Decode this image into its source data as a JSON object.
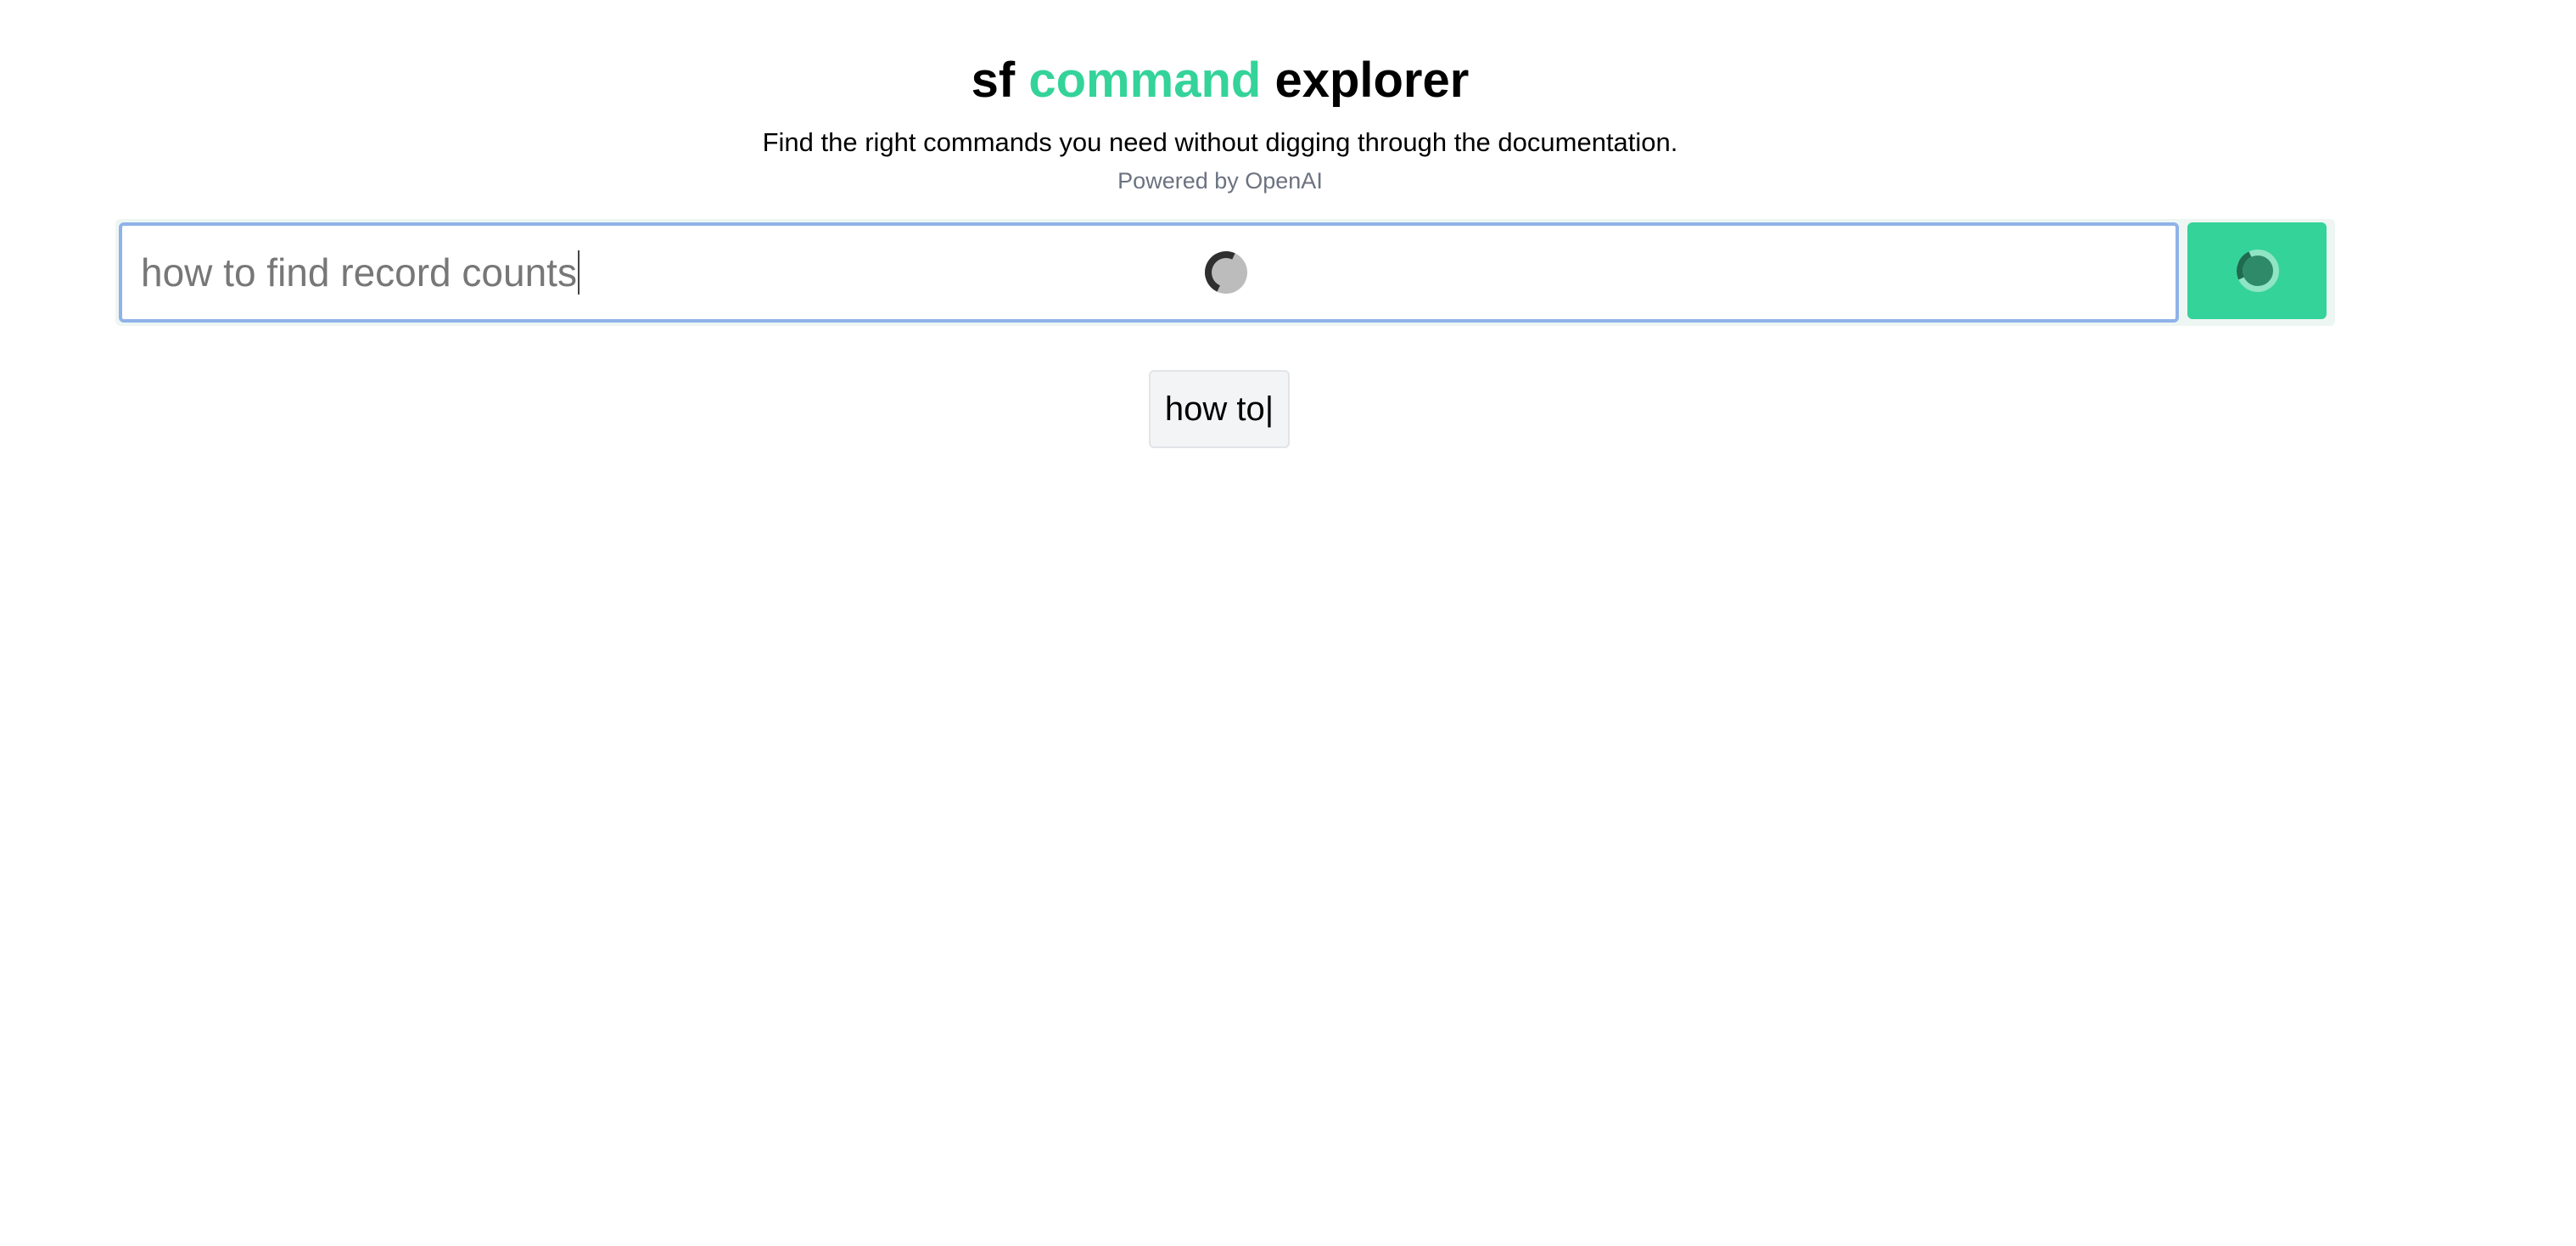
{
  "header": {
    "title_part1": "sf",
    "title_accent": "command",
    "title_part2": "explorer",
    "subtitle": "Find the right commands you need without digging through the documentation.",
    "powered_by": "Powered by OpenAI"
  },
  "search": {
    "value": "how to find record counts",
    "loading": true
  },
  "search_button": {
    "state": "loading",
    "icon": "spinner-icon"
  },
  "typing_preview": {
    "text": "how to|"
  },
  "colors": {
    "accent": "#34d399",
    "input_focus_border": "#8fb2e8",
    "muted_text": "#6b7280"
  }
}
